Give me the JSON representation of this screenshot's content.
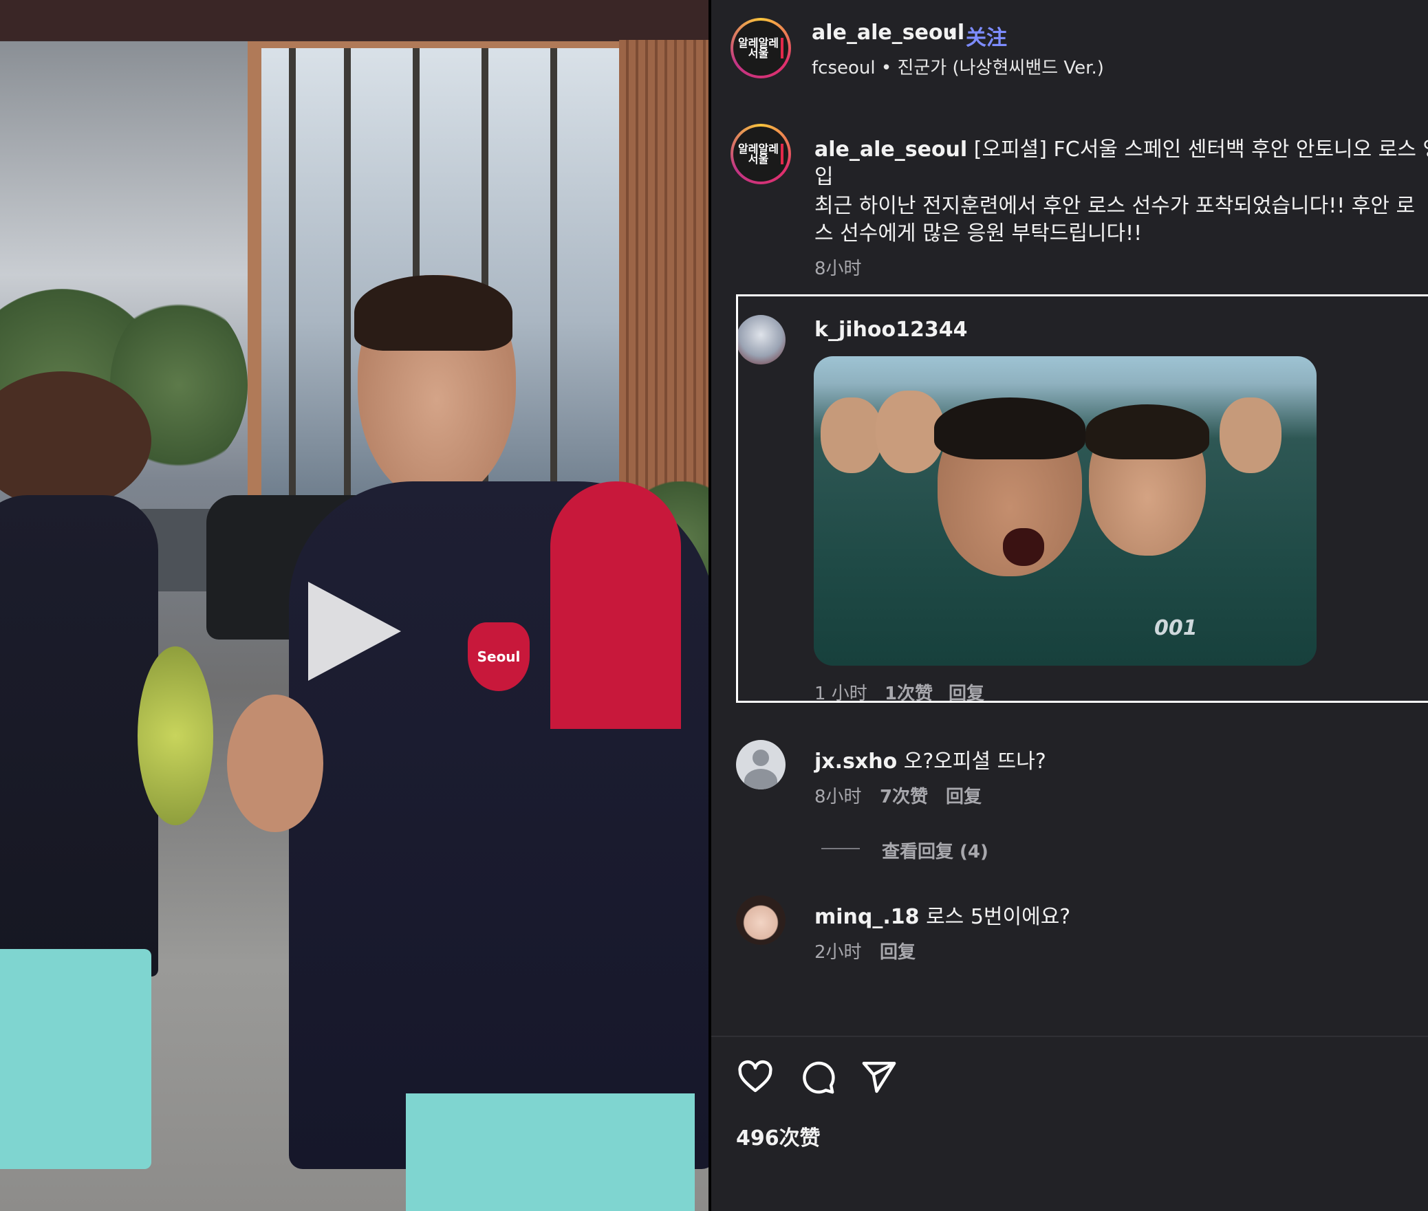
{
  "video": {
    "play_icon": "play-icon",
    "jersey_text": "Seoul"
  },
  "header": {
    "username": "ale_ale_seoul",
    "dot": "•",
    "follow_label": "关注",
    "subline": "fcseoul • 진군가 (나상현씨밴드 Ver.)",
    "avatar_text": "알레알레 서울"
  },
  "caption": {
    "username": "ale_ale_seoul",
    "text_line1": "[오피셜] FC서울 스페인 센터백 후안 안토니오 로스 영",
    "text_line2": "입",
    "text_line3": "최근 하이난 전지훈련에서 후안 로스 선수가 포착되었습니다!! 후안 로",
    "text_line4": "스 선수에게 많은 응원 부탁드립니다!!",
    "time": "8小时"
  },
  "comments": [
    {
      "username": "k_jihoo12344",
      "text": "",
      "time": "1 小时",
      "likes": "1次赞",
      "reply": "回复",
      "gif_label": "001"
    },
    {
      "username": "jx.sxho",
      "text": "오?오피셜 뜨나?",
      "time": "8小时",
      "likes": "7次赞",
      "reply": "回复",
      "view_replies": "查看回复 (4)"
    },
    {
      "username": "minq_.18",
      "text": "로스 5번이에요?",
      "time": "2小时",
      "reply": "回复"
    }
  ],
  "actions": {
    "like_icon": "heart-icon",
    "comment_icon": "comment-icon",
    "share_icon": "send-icon",
    "likes_count": "496次赞"
  },
  "colors": {
    "background": "#222226",
    "follow": "#7d8cff",
    "accent_red": "#e2284b"
  }
}
